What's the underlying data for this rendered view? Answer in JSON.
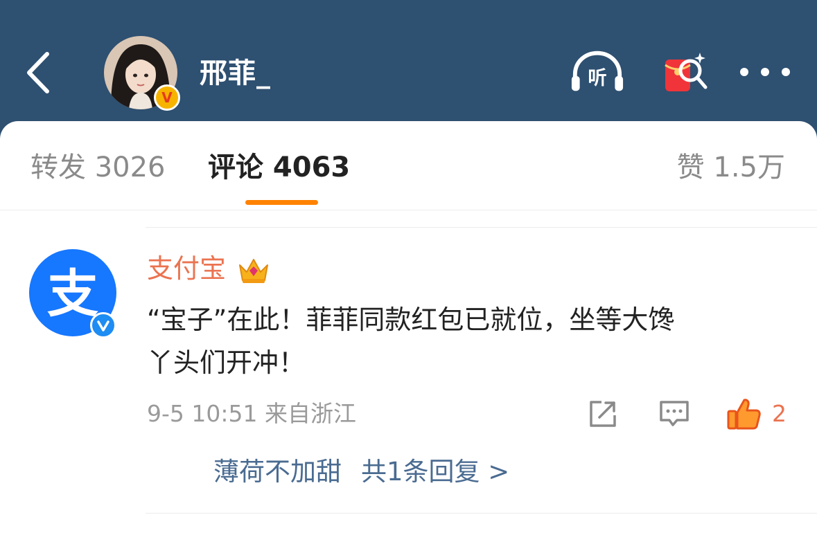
{
  "header": {
    "back_icon": "chevron-left-icon",
    "username": "邢菲_",
    "listen_label": "听",
    "icons": [
      "chevron-left-icon",
      "headphones-icon",
      "red-packet-icon",
      "more-icon"
    ]
  },
  "tabs": {
    "repost": "转发 3026",
    "comment": "评论 4063",
    "like": "赞 1.5万",
    "active": "comment"
  },
  "comment": {
    "author": "支付宝",
    "avatar_glyph": "支",
    "text_line1": "“宝子”在此！菲菲同款红包已就位，坐等大馋",
    "text_line2": "丫头们开冲！",
    "meta": "9-5 10:51 来自浙江",
    "like_count": "2",
    "reply": {
      "author": "薄荷不加甜",
      "count_label": "共1条回复 >"
    }
  },
  "colors": {
    "header_bg": "#2e5071",
    "accent_orange": "#ff8200",
    "name_orange": "#eb7350",
    "link_blue": "#4a6b91",
    "alipay_blue": "#1677ff"
  }
}
